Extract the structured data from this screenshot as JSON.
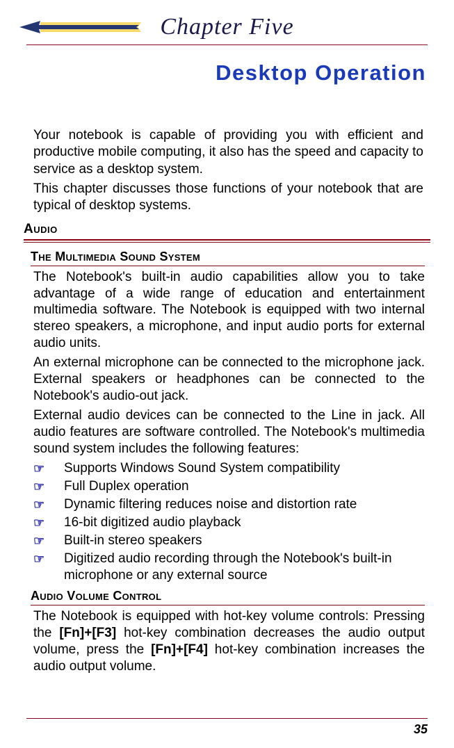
{
  "chapter": {
    "label": "Chapter  Five"
  },
  "title": "Desktop Operation",
  "intro": {
    "p1": "Your notebook is capable of providing you with efficient and productive mobile computing, it also has the speed and capacity to service as a desktop system.",
    "p2": "This chapter discusses those functions of your notebook that are typical of desktop systems."
  },
  "section_audio": {
    "heading": "Audio",
    "sub1": {
      "heading": "The Multimedia Sound System",
      "p1": "The Notebook's built-in audio capabilities allow you to take advantage of a wide range of education and entertainment multimedia software. The Notebook is equipped with two internal stereo speakers, a microphone, and input audio ports for external audio units.",
      "p2": "An external microphone can be connected to the microphone jack. External speakers or headphones can be connected to the Notebook's audio-out jack.",
      "p3": "External audio devices can be connected to the Line in jack. All audio features are software controlled. The Notebook's multimedia sound system includes the following features:",
      "features": [
        "Supports Windows Sound System compatibility",
        "Full Duplex operation",
        "Dynamic filtering reduces noise and distortion rate",
        "16-bit digitized audio playback",
        "Built-in stereo speakers",
        "Digitized audio recording through the Notebook's built-in microphone or any external source"
      ]
    },
    "sub2": {
      "heading": "Audio Volume Control",
      "p1_pre": "The Notebook is equipped with hot-key volume controls: Pressing the ",
      "key1": "[Fn]+[F3]",
      "p1_mid": " hot-key combination decreases the audio output volume, press the ",
      "key2": "[Fn]+[F4]",
      "p1_post": " hot-key combination increases the audio output volume."
    }
  },
  "page_number": "35"
}
